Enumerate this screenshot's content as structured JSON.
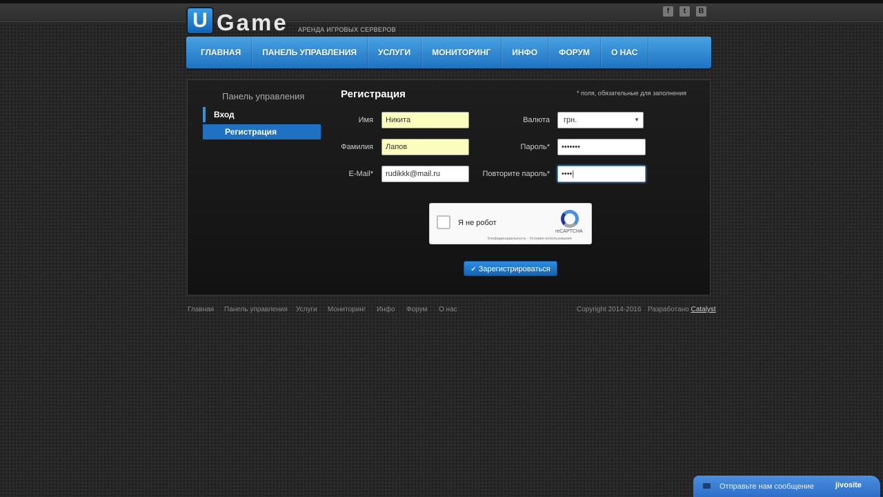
{
  "header": {
    "logo_letter": "U",
    "logo_name": "Game",
    "tagline": "АРЕНДА ИГРОВЫХ СЕРВЕРОВ",
    "social": [
      {
        "icon": "facebook-icon",
        "glyph": "f"
      },
      {
        "icon": "twitter-icon",
        "glyph": "t"
      },
      {
        "icon": "vk-icon",
        "glyph": "В"
      }
    ]
  },
  "nav": {
    "items": [
      "ГЛАВНАЯ",
      "ПАНЕЛЬ УПРАВЛЕНИЯ",
      "УСЛУГИ",
      "МОНИТОРИНГ",
      "ИНФО",
      "ФОРУМ",
      "О НАС"
    ]
  },
  "sidebar": {
    "title": "Панель управления",
    "login": "Вход",
    "register": "Регистрация"
  },
  "form": {
    "title": "Регистрация",
    "required_note": "* поля, обязательные для заполнения",
    "name_label": "Имя",
    "name_value": "Никита",
    "surname_label": "Фамилия",
    "surname_value": "Лапов",
    "email_label": "E-Mail*",
    "email_value": "rudikkk@mail.ru",
    "currency_label": "Валюта",
    "currency_value": "грн.",
    "password_label": "Пароль*",
    "password_value": "•••••••",
    "password_repeat_label": "Повторите пароль*",
    "password_repeat_value": "••••|",
    "submit_label": "Зарегистрироваться"
  },
  "captcha": {
    "text": "Я не робот",
    "brand": "reCAPTCHA",
    "links": "Конфиденциальность - Условия использования"
  },
  "footer": {
    "links": [
      "Главная",
      "Панель управления",
      "Услуги",
      "Мониторинг",
      "Инфо",
      "Форум",
      "О нас"
    ],
    "copyright": "Copyright 2014-2016",
    "developed_by": "Разработано",
    "developer": "Catalyst"
  },
  "chat": {
    "text": "Отправьте нам сообщение",
    "brand": "jivosite"
  },
  "colors": {
    "accent": "#1f72c2",
    "nav_top": "#48a2e2",
    "input_autofill": "#fbfdbe"
  }
}
